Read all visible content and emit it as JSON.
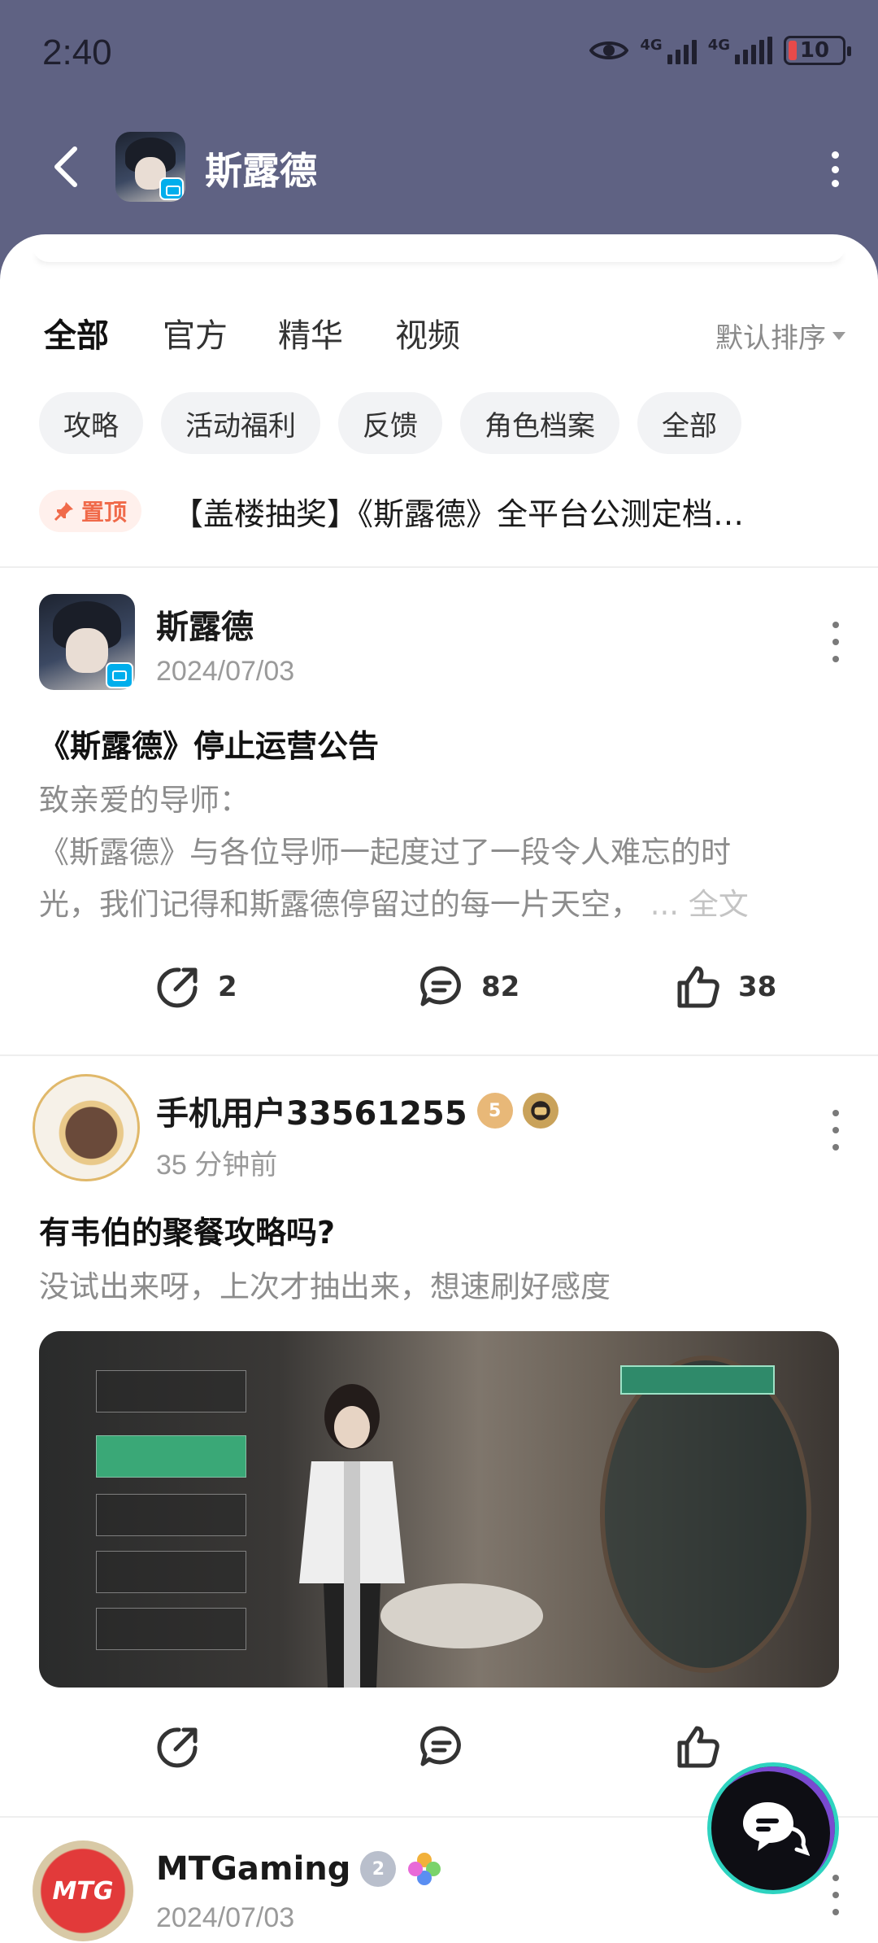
{
  "status_bar": {
    "time": "2:40",
    "net1": "4G",
    "net2": "4G",
    "battery": "10"
  },
  "header": {
    "title": "斯露德"
  },
  "tabs": [
    {
      "label": "全部",
      "active": true
    },
    {
      "label": "官方",
      "active": false
    },
    {
      "label": "精华",
      "active": false
    },
    {
      "label": "视频",
      "active": false
    }
  ],
  "sort_label": "默认排序",
  "chips": [
    "攻略",
    "活动福利",
    "反馈",
    "角色档案",
    "全部"
  ],
  "pinned": {
    "badge": "置顶",
    "title": "【盖楼抽奖】《斯露德》全平台公测定档…"
  },
  "posts": [
    {
      "author": "斯露德",
      "date": "2024/07/03",
      "title": "《斯露德》停止运营公告",
      "body_line1": "致亲爱的导师：",
      "body_line2": "《斯露德》与各位导师一起度过了一段令人难忘的时",
      "body_line3": "光，我们记得和斯露德停留过的每一片天空，",
      "more": "... 全文",
      "shares": "2",
      "comments": "82",
      "likes": "38"
    },
    {
      "author": "手机用户33561255",
      "level": "5",
      "date": "35 分钟前",
      "title": "有韦伯的聚餐攻略吗?",
      "body": "没试出来呀，上次才抽出来，想速刷好感度"
    },
    {
      "author": "MTGaming",
      "level": "2",
      "avatar_text": "MTG",
      "date": "2024/07/03"
    }
  ],
  "colors": {
    "header_bg": "#5f6283",
    "accent": "#2ed3c0",
    "pin": "#f06a4a"
  }
}
